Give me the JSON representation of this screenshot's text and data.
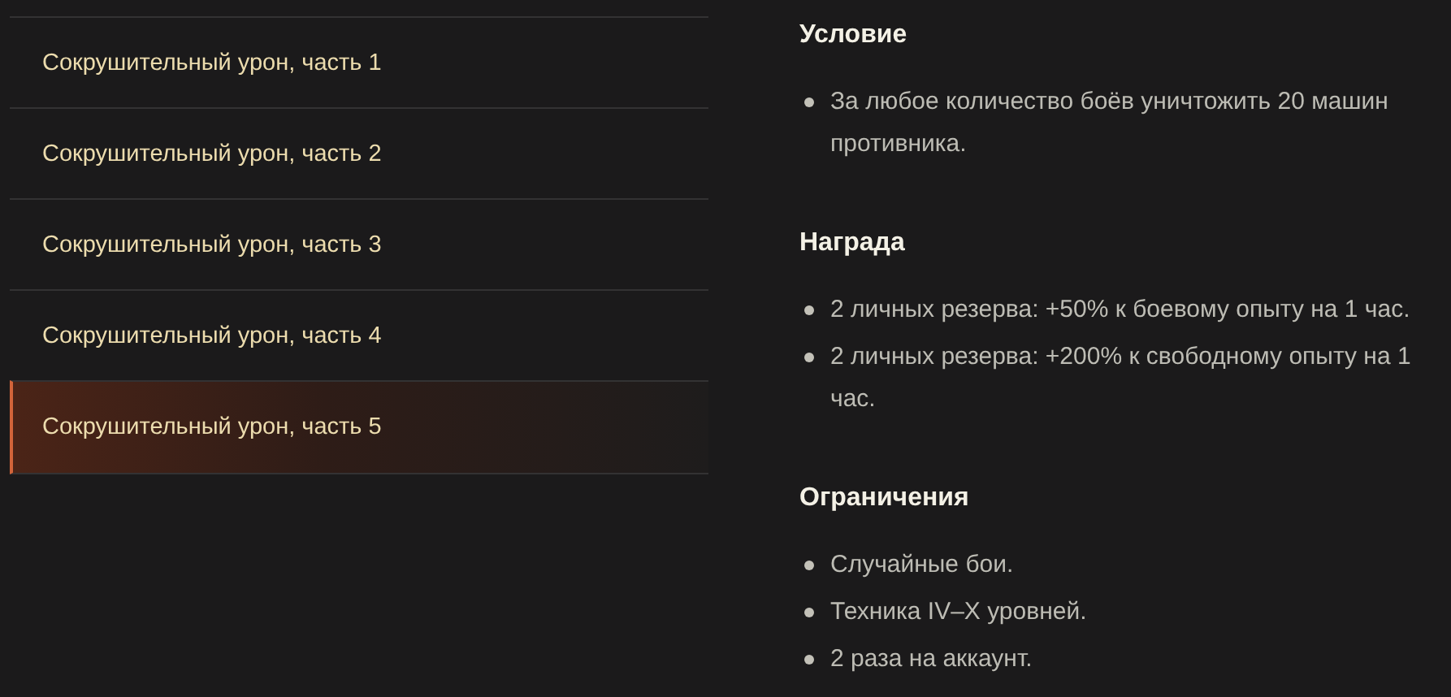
{
  "parts": [
    {
      "label": "Сокрушительный урон, часть 1",
      "selected": false
    },
    {
      "label": "Сокрушительный урон, часть 2",
      "selected": false
    },
    {
      "label": "Сокрушительный урон, часть 3",
      "selected": false
    },
    {
      "label": "Сокрушительный урон, часть 4",
      "selected": false
    },
    {
      "label": "Сокрушительный урон, часть 5",
      "selected": true
    }
  ],
  "sections": [
    {
      "title": "Условие",
      "items": [
        "За любое количество боёв уничтожить 20 машин противника."
      ]
    },
    {
      "title": "Награда",
      "items": [
        "2 личных резерва: +50% к боевому опыту на 1 час.",
        "2 личных резерва: +200% к свободному опыту на 1 час."
      ]
    },
    {
      "title": "Ограничения",
      "items": [
        "Случайные бои.",
        "Техника IV–X уровней.",
        "2 раза на аккаунт."
      ]
    }
  ]
}
